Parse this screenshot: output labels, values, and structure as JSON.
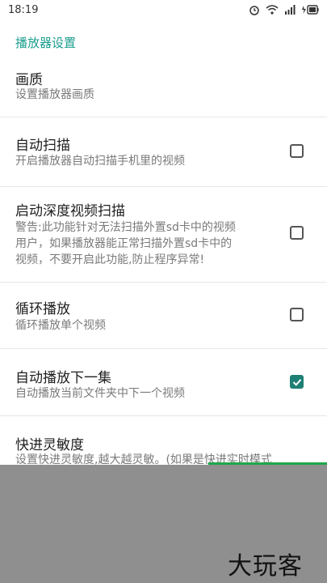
{
  "status_bar": {
    "time": "18:19",
    "icons": [
      "alarm-icon",
      "wifi-icon",
      "signal-icon",
      "battery-icon"
    ]
  },
  "header": {
    "section_title": "播放器设置"
  },
  "preferences": [
    {
      "title": "画质",
      "summary": "设置播放器画质",
      "has_checkbox": false
    },
    {
      "title": "自动扫描",
      "summary": "开启播放器自动扫描手机里的视频",
      "has_checkbox": true,
      "checked": false
    },
    {
      "title": "启动深度视频扫描",
      "summary_lines": [
        "警告:此功能针对无法扫描外置sd卡中的视频",
        "用户，如果播放器能正常扫描外置sd卡中的",
        "视频，不要开启此功能,防止程序异常!"
      ],
      "has_checkbox": true,
      "checked": false
    },
    {
      "title": "循环播放",
      "summary": "循环播放单个视频",
      "has_checkbox": true,
      "checked": false
    },
    {
      "title": "自动播放下一集",
      "summary": "自动播放当前文件夹中下一个视频",
      "has_checkbox": true,
      "checked": true
    },
    {
      "title": "快进灵敏度",
      "summary": "设置快进灵敏度,越大越灵敏。(如果是快进实时模式",
      "has_checkbox": false
    }
  ],
  "watermark": "大玩客",
  "colors": {
    "accent": "#1b9e8e",
    "checkbox_checked": "#1e7f74",
    "overlay": "#8f8f8f"
  }
}
